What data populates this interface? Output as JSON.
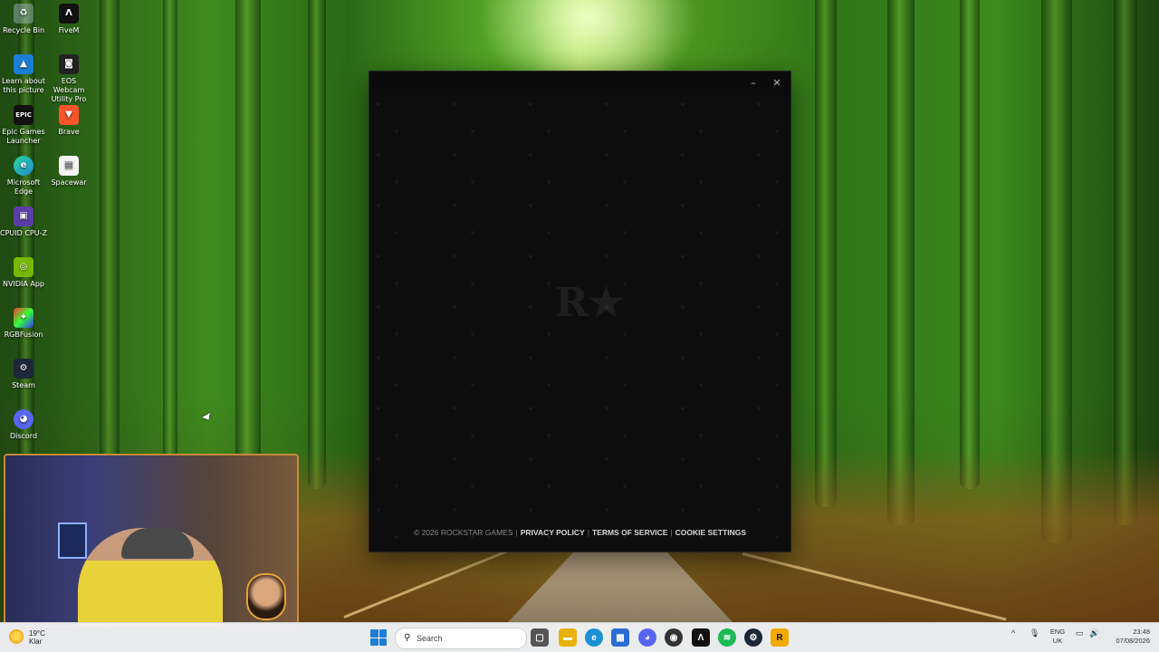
{
  "desktop_icons": [
    {
      "label": "Recycle Bin",
      "icon": "recycle-bin-icon"
    },
    {
      "label": "FiveM",
      "icon": "fivem-icon"
    },
    {
      "label": "Learn about this picture",
      "icon": "learn-picture-icon"
    },
    {
      "label": "EOS Webcam Utility Pro",
      "icon": "camera-icon"
    },
    {
      "label": "Epic Games Launcher",
      "icon": "epic-games-icon"
    },
    {
      "label": "Brave",
      "icon": "brave-icon"
    },
    {
      "label": "Microsoft Edge",
      "icon": "edge-icon"
    },
    {
      "label": "Spacewar",
      "icon": "file-icon"
    },
    {
      "label": "CPUID CPU-Z",
      "icon": "cpuz-icon"
    },
    {
      "label": "NVIDIA App",
      "icon": "nvidia-icon"
    },
    {
      "label": "RGBFusion",
      "icon": "rgbfusion-icon"
    },
    {
      "label": "Steam",
      "icon": "steam-icon"
    },
    {
      "label": "Discord",
      "icon": "discord-icon"
    }
  ],
  "launcher": {
    "minimize_glyph": "–",
    "close_glyph": "✕",
    "logo_glyph": "R★",
    "footer": {
      "copyright": "© 2026 ROCKSTAR GAMES",
      "separator": "|",
      "privacy": "PRIVACY POLICY",
      "terms": "TERMS OF SERVICE",
      "cookies": "COOKIE SETTINGS"
    }
  },
  "taskbar": {
    "weather_temp": "19°C",
    "weather_desc": "Klar",
    "search_placeholder": "Search",
    "apps": [
      {
        "name": "task-view",
        "icon": "task-view-icon",
        "color": "#555555",
        "glyph": "▢"
      },
      {
        "name": "file-explorer",
        "icon": "folder-icon",
        "color": "#e8b10e",
        "glyph": "▬"
      },
      {
        "name": "edge",
        "icon": "edge-icon",
        "color": "#1b8fd4",
        "glyph": "e"
      },
      {
        "name": "store",
        "icon": "store-icon",
        "color": "#2b6cd4",
        "glyph": "▦"
      },
      {
        "name": "discord",
        "icon": "discord-icon",
        "color": "#5865f2",
        "glyph": "◕"
      },
      {
        "name": "obs",
        "icon": "obs-icon",
        "color": "#333333",
        "glyph": "◉"
      },
      {
        "name": "fivem",
        "icon": "fivem-icon",
        "color": "#111111",
        "glyph": "Λ"
      },
      {
        "name": "spotify",
        "icon": "spotify-icon",
        "color": "#1db954",
        "glyph": "≋"
      },
      {
        "name": "steam",
        "icon": "steam-icon",
        "color": "#1b2838",
        "glyph": "⚙"
      },
      {
        "name": "rockstar",
        "icon": "rockstar-icon",
        "color": "#f2a900",
        "glyph": "R"
      }
    ],
    "tray": {
      "chevron": "^",
      "mic": "🎙",
      "lang_top": "ENG",
      "lang_bottom": "UK",
      "network": "▭",
      "volume": "🔊",
      "time": "23:48",
      "date": "07/08/2026"
    }
  },
  "colors": {
    "accent": "#f2a900",
    "launcher_bg": "#0d0d0d"
  }
}
